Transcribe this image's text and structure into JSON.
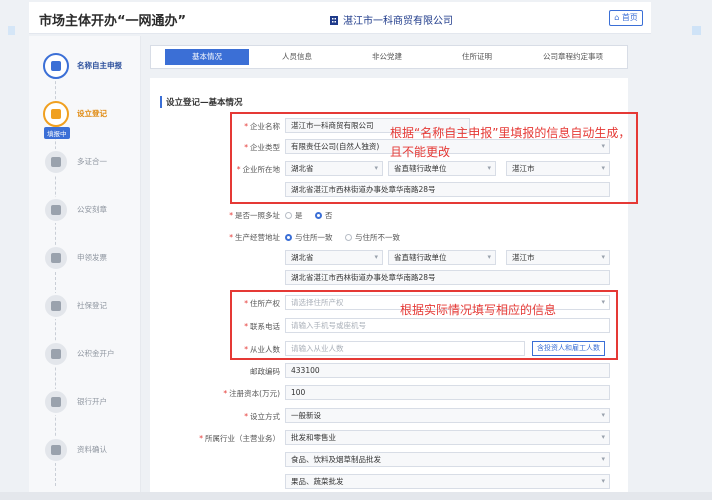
{
  "header": {
    "title": "市场主体开办“一网通办”",
    "company": "湛江市一科商贸有限公司",
    "home_label": "首页"
  },
  "sidebar": {
    "badge": "填报中",
    "steps": [
      {
        "label": "名称自主申报",
        "state": "active",
        "icon": "edit-icon"
      },
      {
        "label": "设立登记",
        "state": "current",
        "icon": "document-icon"
      },
      {
        "label": "多证合一",
        "state": "pending",
        "icon": "certificate-icon"
      },
      {
        "label": "公安刻章",
        "state": "pending",
        "icon": "stamp-icon"
      },
      {
        "label": "申领发票",
        "state": "pending",
        "icon": "invoice-icon"
      },
      {
        "label": "社保登记",
        "state": "pending",
        "icon": "shield-icon"
      },
      {
        "label": "公积金开户",
        "state": "pending",
        "icon": "home-icon"
      },
      {
        "label": "银行开户",
        "state": "pending",
        "icon": "bank-icon"
      },
      {
        "label": "资料确认",
        "state": "pending",
        "icon": "checklist-icon"
      }
    ]
  },
  "tabs": [
    "基本情况",
    "人员信息",
    "非公党建",
    "住所证明",
    "公司章程约定事项"
  ],
  "section_title": "设立登记—基本情况",
  "form": {
    "company_name": {
      "label": "企业名称",
      "value": "湛江市一科商贸有限公司"
    },
    "company_type": {
      "label": "企业类型",
      "value": "有限责任公司(自然人独资)"
    },
    "location": {
      "label": "企业所在地",
      "province": "湖北省",
      "unit": "省直辖行政单位",
      "city": "湛江市",
      "address": "湖北省湛江市西林街道办事处章华南路28号"
    },
    "one_photo": {
      "label": "是否一照多址",
      "options": [
        "是",
        "否"
      ],
      "selected": "否"
    },
    "biz_address": {
      "label": "生产经营地址",
      "options": [
        "与住所一致",
        "与住所不一致"
      ],
      "selected": "与住所一致",
      "province": "湖北省",
      "unit": "省直辖行政单位",
      "city": "湛江市",
      "address": "湖北省湛江市西林街道办事处章华南路28号"
    },
    "property": {
      "label": "住所产权",
      "placeholder": "请选择住所产权"
    },
    "phone": {
      "label": "联系电话",
      "placeholder": "请输入手机号或座机号"
    },
    "staff": {
      "label": "从业人数",
      "placeholder": "请输入从业人数",
      "button": "含投资人和雇工人数"
    },
    "postcode": {
      "label": "邮政编码",
      "value": "433100"
    },
    "capital": {
      "label": "注册资本(万元)",
      "value": "100"
    },
    "method": {
      "label": "设立方式",
      "value": "一般新设"
    },
    "industry": {
      "label": "所属行业（主营业务）",
      "values": [
        "批发和零售业",
        "食品、饮料及烟草制品批发",
        "果品、蔬菜批发"
      ]
    }
  },
  "annotations": {
    "note1": "根据“名称自主申报”里填报的信息自动生成，且不能更改",
    "note2": "根据实际情况填写相应的信息"
  },
  "colors": {
    "accent": "#3b6fd6",
    "annotation": "#e53935",
    "in_progress": "#f0a020"
  }
}
